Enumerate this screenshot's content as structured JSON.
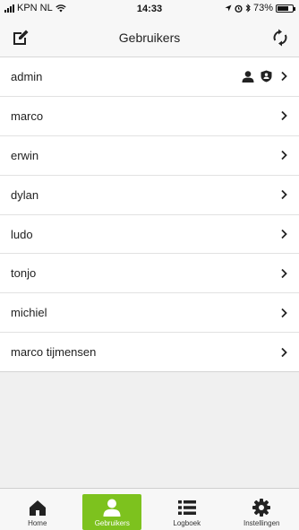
{
  "status": {
    "carrier": "KPN NL",
    "time": "14:33",
    "battery": "73%",
    "battery_level": 0.73
  },
  "header": {
    "title": "Gebruikers",
    "edit_icon": "edit-icon",
    "sync_icon": "sync-icon"
  },
  "users": [
    {
      "name": "admin",
      "badges": [
        "person-icon",
        "shield-icon"
      ]
    },
    {
      "name": "marco"
    },
    {
      "name": "erwin"
    },
    {
      "name": "dylan"
    },
    {
      "name": "ludo"
    },
    {
      "name": "tonjo"
    },
    {
      "name": "michiel"
    },
    {
      "name": "marco tijmensen"
    }
  ],
  "tabs": [
    {
      "label": "Home",
      "icon": "home-icon",
      "active": false
    },
    {
      "label": "Gebruikers",
      "icon": "person-icon",
      "active": true
    },
    {
      "label": "Logboek",
      "icon": "list-icon",
      "active": false
    },
    {
      "label": "Instellingen",
      "icon": "gear-icon",
      "active": false
    }
  ],
  "colors": {
    "accent": "#7dc21e",
    "background": "#f0f0f0",
    "list_background": "#ffffff"
  }
}
